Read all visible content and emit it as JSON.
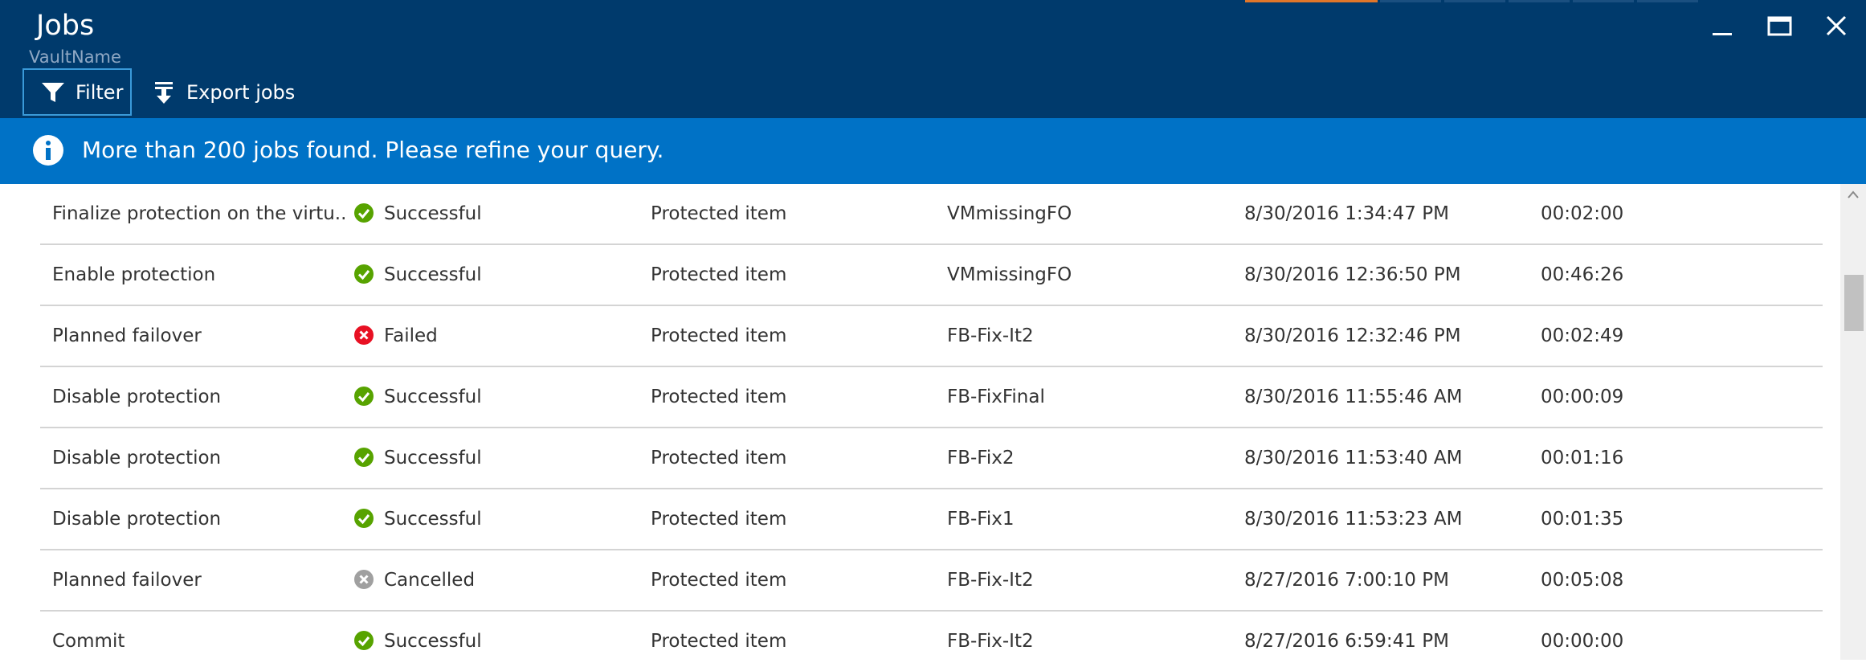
{
  "header": {
    "title": "Jobs",
    "subtitle": "VaultName",
    "background": "#003a6c",
    "active_tab_color": "#e0762a",
    "window_controls": [
      "minimize-icon",
      "maximize-icon",
      "close-icon"
    ]
  },
  "toolbar": {
    "filter_label": "Filter",
    "filter_icon": "filter-icon",
    "export_label": "Export jobs",
    "export_icon": "export-icon"
  },
  "banner": {
    "message": "More than 200 jobs found. Please refine your query.",
    "icon": "info-icon",
    "background": "#0072c6"
  },
  "status_colors": {
    "Successful": "#57a300",
    "Failed": "#e81123",
    "Cancelled": "#a0a0a0"
  },
  "jobs": [
    {
      "name": "Finalize protection on the virtu...",
      "status": "Successful",
      "type": "Protected item",
      "item": "VMmissingFO",
      "start": "8/30/2016 1:34:47 PM",
      "duration": "00:02:00"
    },
    {
      "name": "Enable protection",
      "status": "Successful",
      "type": "Protected item",
      "item": "VMmissingFO",
      "start": "8/30/2016 12:36:50 PM",
      "duration": "00:46:26"
    },
    {
      "name": "Planned failover",
      "status": "Failed",
      "type": "Protected item",
      "item": "FB-Fix-It2",
      "start": "8/30/2016 12:32:46 PM",
      "duration": "00:02:49"
    },
    {
      "name": "Disable protection",
      "status": "Successful",
      "type": "Protected item",
      "item": "FB-FixFinal",
      "start": "8/30/2016 11:55:46 AM",
      "duration": "00:00:09"
    },
    {
      "name": "Disable protection",
      "status": "Successful",
      "type": "Protected item",
      "item": "FB-Fix2",
      "start": "8/30/2016 11:53:40 AM",
      "duration": "00:01:16"
    },
    {
      "name": "Disable protection",
      "status": "Successful",
      "type": "Protected item",
      "item": "FB-Fix1",
      "start": "8/30/2016 11:53:23 AM",
      "duration": "00:01:35"
    },
    {
      "name": "Planned failover",
      "status": "Cancelled",
      "type": "Protected item",
      "item": "FB-Fix-It2",
      "start": "8/27/2016 7:00:10 PM",
      "duration": "00:05:08"
    },
    {
      "name": "Commit",
      "status": "Successful",
      "type": "Protected item",
      "item": "FB-Fix-It2",
      "start": "8/27/2016 6:59:41 PM",
      "duration": "00:00:00"
    }
  ]
}
